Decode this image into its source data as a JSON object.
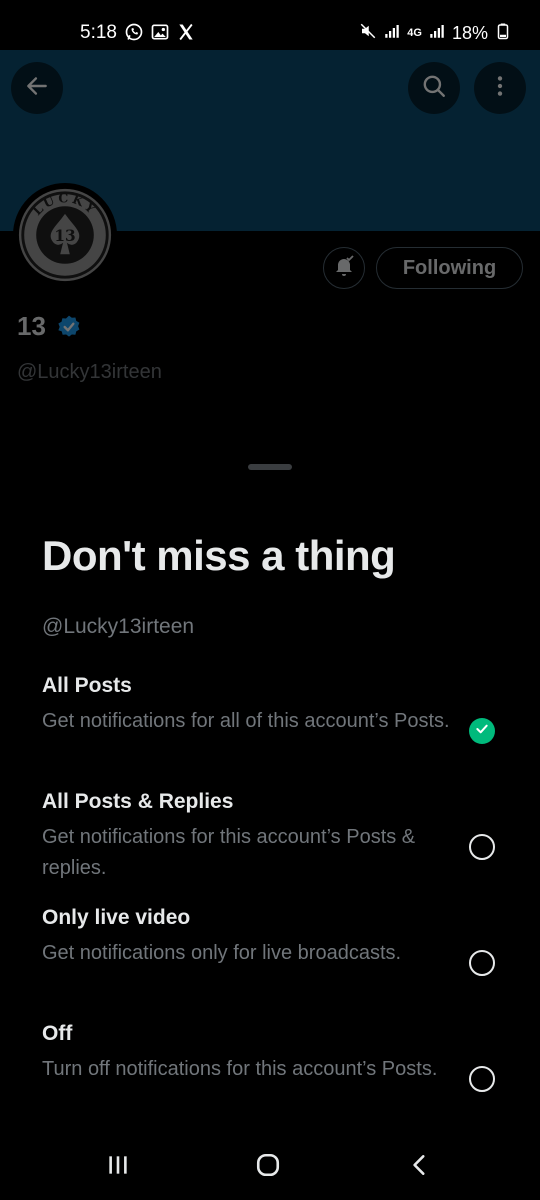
{
  "status_bar": {
    "time": "5:18",
    "left_icons": [
      "whatsapp-icon",
      "gallery-icon",
      "x-logo-icon"
    ],
    "network": "4G",
    "battery": "18%"
  },
  "header": {
    "back_icon": "arrow-left-icon",
    "search_icon": "search-icon",
    "more_icon": "more-vertical-icon",
    "banner_color": "#0d4d70"
  },
  "profile": {
    "avatar_text_top": "LUCKY",
    "avatar_text_center": "13",
    "name": "13",
    "handle": "@Lucky13irteen",
    "following_label": "Following",
    "notification_icon": "bell-check-icon",
    "verified_color": "#1d9bf0"
  },
  "sheet": {
    "title": "Don't miss a thing",
    "handle": "@Lucky13irteen",
    "options": [
      {
        "title": "All Posts",
        "description": "Get notifications for all of this account’s Posts.",
        "selected": true
      },
      {
        "title": "All Posts & Replies",
        "description": "Get notifications for this account’s Posts & replies.",
        "selected": false
      },
      {
        "title": "Only live video",
        "description": "Get notifications only for live broadcasts.",
        "selected": false
      },
      {
        "title": "Off",
        "description": "Turn off notifications for this account’s Posts.",
        "selected": false
      }
    ],
    "selected_color": "#00ba7c"
  },
  "nav_bar": {
    "recents_icon": "recents-icon",
    "home_icon": "home-icon",
    "back_icon": "back-chevron-icon"
  }
}
